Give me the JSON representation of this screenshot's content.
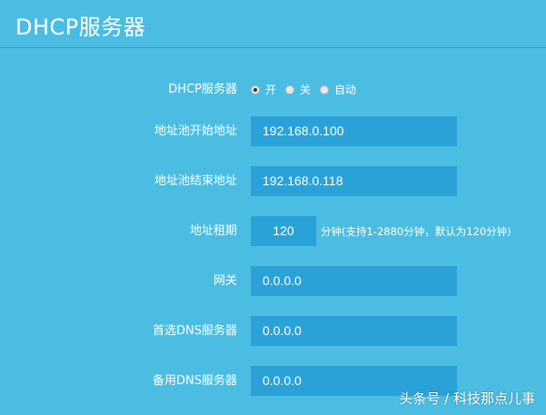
{
  "page": {
    "title": "DHCP服务器"
  },
  "colors": {
    "background": "#4bbde2",
    "field": "#2aa2d8",
    "divider": "#2f9fcf",
    "text": "#ffffff"
  },
  "form": {
    "dhcp_server": {
      "label": "DHCP服务器",
      "options": [
        {
          "label": "开",
          "selected": true
        },
        {
          "label": "关",
          "selected": false
        },
        {
          "label": "自动",
          "selected": false
        }
      ]
    },
    "pool_start": {
      "label": "地址池开始地址",
      "value": "192.168.0.100"
    },
    "pool_end": {
      "label": "地址池结束地址",
      "value": "192.168.0.118"
    },
    "lease": {
      "label": "地址租期",
      "value": "120",
      "hint": "分钟(支持1-2880分钟，默认为120分钟)"
    },
    "gateway": {
      "label": "网关",
      "value": "0.0.0.0"
    },
    "primary_dns": {
      "label": "首选DNS服务器",
      "value": "0.0.0.0"
    },
    "secondary_dns": {
      "label": "备用DNS服务器",
      "value": "0.0.0.0"
    }
  },
  "watermark": {
    "text": "头条号 / 科技那点儿事"
  }
}
